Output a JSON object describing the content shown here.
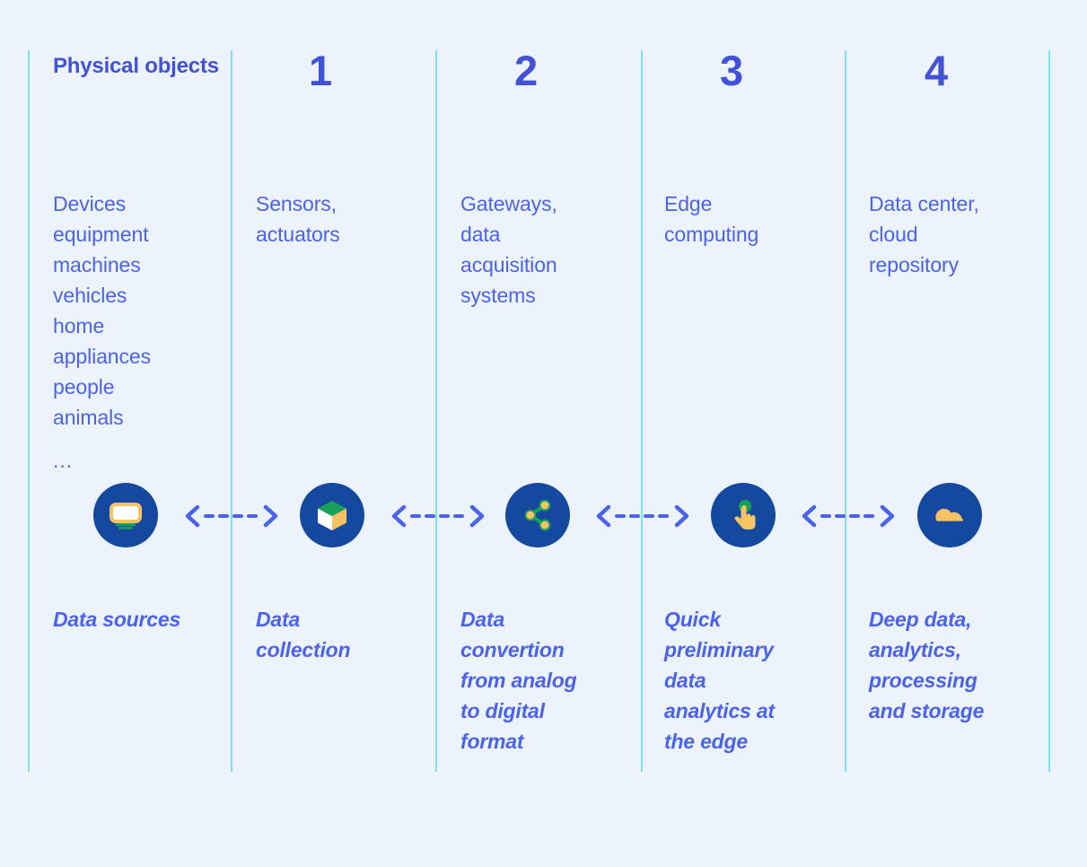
{
  "theme": {
    "background": "#edf3fd",
    "divider_color": "#7ce4e9",
    "text_blue": "#4a63e8",
    "heading_blue": "#4052d6",
    "icon_circle": "#14499f",
    "icon_yellow": "#f8c265",
    "icon_green": "#17a05a",
    "icon_white": "#ffffff",
    "arrow_color": "#4a63e8"
  },
  "columns": [
    {
      "number": "",
      "title": "Physical\nobjects",
      "items": "Devices\nequipment\nmachines\nvehicles\nhome\nappliances\npeople\nanimals",
      "ellipsis": "...",
      "icon": "device-screen-icon",
      "caption": "Data sources"
    },
    {
      "number": "1",
      "title": "",
      "items": "Sensors,\nactuators",
      "ellipsis": "",
      "icon": "cube-box-icon",
      "caption": "Data\ncollection"
    },
    {
      "number": "2",
      "title": "",
      "items": "Gateways,\ndata\nacquisition\nsystems",
      "ellipsis": "",
      "icon": "share-nodes-icon",
      "caption": "Data\nconvertion\nfrom analog\nto digital\nformat"
    },
    {
      "number": "3",
      "title": "",
      "items": "Edge\ncomputing",
      "ellipsis": "",
      "icon": "tap-hand-icon",
      "caption": "Quick\npreliminary\ndata\nanalytics at\nthe edge"
    },
    {
      "number": "4",
      "title": "",
      "items": "Data center,\ncloud\nrepository",
      "ellipsis": "",
      "icon": "cloud-icon",
      "caption": "Deep data,\nanalytics,\nprocessing\nand storage"
    }
  ],
  "connectors": [
    {
      "name": "connector-1",
      "direction": "bidirectional-dashed"
    },
    {
      "name": "connector-2",
      "direction": "bidirectional-dashed"
    },
    {
      "name": "connector-3",
      "direction": "bidirectional-dashed"
    },
    {
      "name": "connector-4",
      "direction": "bidirectional-dashed"
    }
  ]
}
